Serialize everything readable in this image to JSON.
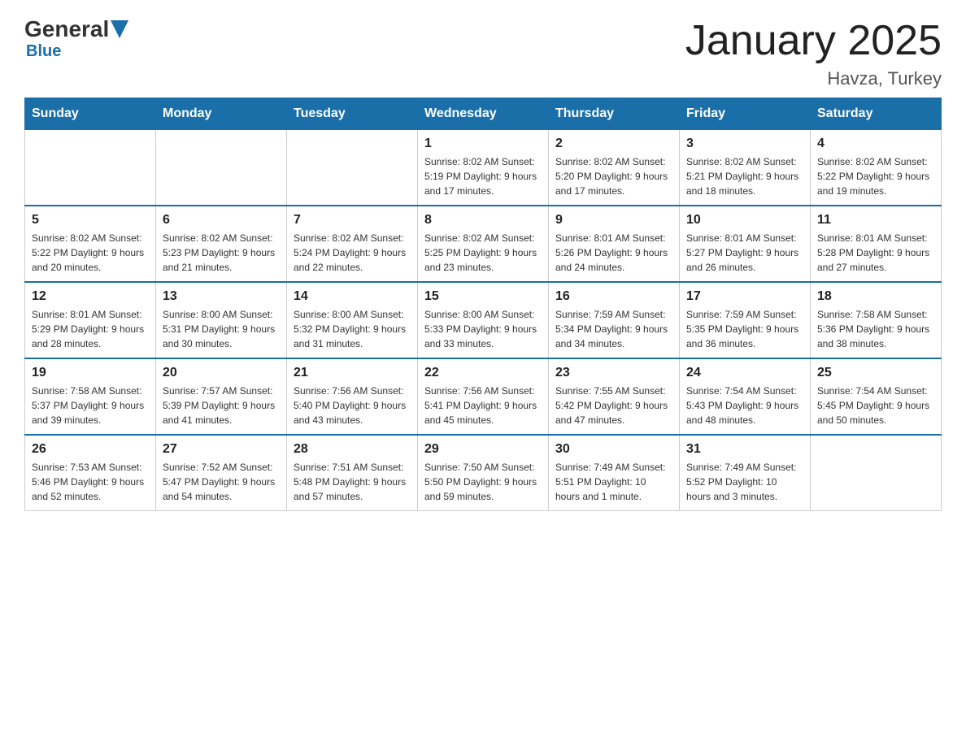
{
  "header": {
    "logo_general": "General",
    "logo_blue": "Blue",
    "title": "January 2025",
    "location": "Havza, Turkey"
  },
  "columns": [
    "Sunday",
    "Monday",
    "Tuesday",
    "Wednesday",
    "Thursday",
    "Friday",
    "Saturday"
  ],
  "weeks": [
    [
      {
        "day": "",
        "info": ""
      },
      {
        "day": "",
        "info": ""
      },
      {
        "day": "",
        "info": ""
      },
      {
        "day": "1",
        "info": "Sunrise: 8:02 AM\nSunset: 5:19 PM\nDaylight: 9 hours\nand 17 minutes."
      },
      {
        "day": "2",
        "info": "Sunrise: 8:02 AM\nSunset: 5:20 PM\nDaylight: 9 hours\nand 17 minutes."
      },
      {
        "day": "3",
        "info": "Sunrise: 8:02 AM\nSunset: 5:21 PM\nDaylight: 9 hours\nand 18 minutes."
      },
      {
        "day": "4",
        "info": "Sunrise: 8:02 AM\nSunset: 5:22 PM\nDaylight: 9 hours\nand 19 minutes."
      }
    ],
    [
      {
        "day": "5",
        "info": "Sunrise: 8:02 AM\nSunset: 5:22 PM\nDaylight: 9 hours\nand 20 minutes."
      },
      {
        "day": "6",
        "info": "Sunrise: 8:02 AM\nSunset: 5:23 PM\nDaylight: 9 hours\nand 21 minutes."
      },
      {
        "day": "7",
        "info": "Sunrise: 8:02 AM\nSunset: 5:24 PM\nDaylight: 9 hours\nand 22 minutes."
      },
      {
        "day": "8",
        "info": "Sunrise: 8:02 AM\nSunset: 5:25 PM\nDaylight: 9 hours\nand 23 minutes."
      },
      {
        "day": "9",
        "info": "Sunrise: 8:01 AM\nSunset: 5:26 PM\nDaylight: 9 hours\nand 24 minutes."
      },
      {
        "day": "10",
        "info": "Sunrise: 8:01 AM\nSunset: 5:27 PM\nDaylight: 9 hours\nand 26 minutes."
      },
      {
        "day": "11",
        "info": "Sunrise: 8:01 AM\nSunset: 5:28 PM\nDaylight: 9 hours\nand 27 minutes."
      }
    ],
    [
      {
        "day": "12",
        "info": "Sunrise: 8:01 AM\nSunset: 5:29 PM\nDaylight: 9 hours\nand 28 minutes."
      },
      {
        "day": "13",
        "info": "Sunrise: 8:00 AM\nSunset: 5:31 PM\nDaylight: 9 hours\nand 30 minutes."
      },
      {
        "day": "14",
        "info": "Sunrise: 8:00 AM\nSunset: 5:32 PM\nDaylight: 9 hours\nand 31 minutes."
      },
      {
        "day": "15",
        "info": "Sunrise: 8:00 AM\nSunset: 5:33 PM\nDaylight: 9 hours\nand 33 minutes."
      },
      {
        "day": "16",
        "info": "Sunrise: 7:59 AM\nSunset: 5:34 PM\nDaylight: 9 hours\nand 34 minutes."
      },
      {
        "day": "17",
        "info": "Sunrise: 7:59 AM\nSunset: 5:35 PM\nDaylight: 9 hours\nand 36 minutes."
      },
      {
        "day": "18",
        "info": "Sunrise: 7:58 AM\nSunset: 5:36 PM\nDaylight: 9 hours\nand 38 minutes."
      }
    ],
    [
      {
        "day": "19",
        "info": "Sunrise: 7:58 AM\nSunset: 5:37 PM\nDaylight: 9 hours\nand 39 minutes."
      },
      {
        "day": "20",
        "info": "Sunrise: 7:57 AM\nSunset: 5:39 PM\nDaylight: 9 hours\nand 41 minutes."
      },
      {
        "day": "21",
        "info": "Sunrise: 7:56 AM\nSunset: 5:40 PM\nDaylight: 9 hours\nand 43 minutes."
      },
      {
        "day": "22",
        "info": "Sunrise: 7:56 AM\nSunset: 5:41 PM\nDaylight: 9 hours\nand 45 minutes."
      },
      {
        "day": "23",
        "info": "Sunrise: 7:55 AM\nSunset: 5:42 PM\nDaylight: 9 hours\nand 47 minutes."
      },
      {
        "day": "24",
        "info": "Sunrise: 7:54 AM\nSunset: 5:43 PM\nDaylight: 9 hours\nand 48 minutes."
      },
      {
        "day": "25",
        "info": "Sunrise: 7:54 AM\nSunset: 5:45 PM\nDaylight: 9 hours\nand 50 minutes."
      }
    ],
    [
      {
        "day": "26",
        "info": "Sunrise: 7:53 AM\nSunset: 5:46 PM\nDaylight: 9 hours\nand 52 minutes."
      },
      {
        "day": "27",
        "info": "Sunrise: 7:52 AM\nSunset: 5:47 PM\nDaylight: 9 hours\nand 54 minutes."
      },
      {
        "day": "28",
        "info": "Sunrise: 7:51 AM\nSunset: 5:48 PM\nDaylight: 9 hours\nand 57 minutes."
      },
      {
        "day": "29",
        "info": "Sunrise: 7:50 AM\nSunset: 5:50 PM\nDaylight: 9 hours\nand 59 minutes."
      },
      {
        "day": "30",
        "info": "Sunrise: 7:49 AM\nSunset: 5:51 PM\nDaylight: 10 hours\nand 1 minute."
      },
      {
        "day": "31",
        "info": "Sunrise: 7:49 AM\nSunset: 5:52 PM\nDaylight: 10 hours\nand 3 minutes."
      },
      {
        "day": "",
        "info": ""
      }
    ]
  ]
}
